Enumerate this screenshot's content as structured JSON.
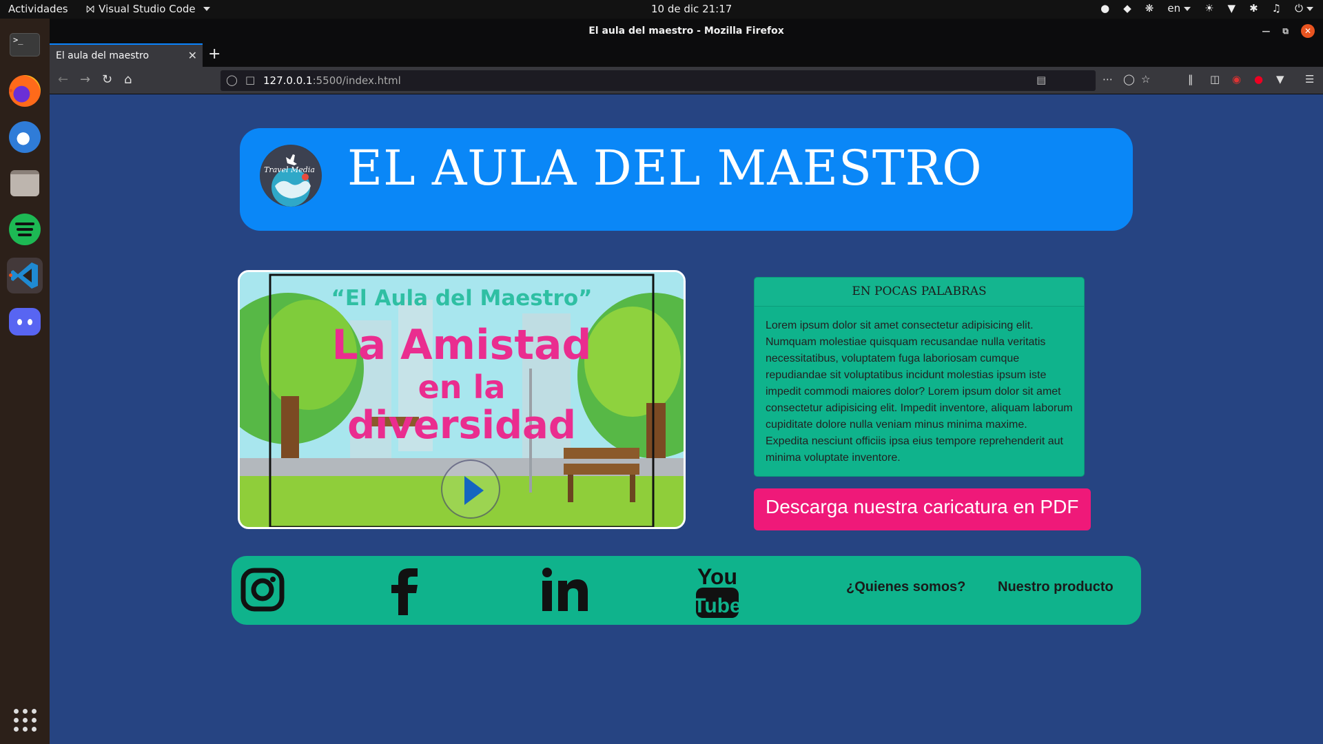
{
  "system": {
    "activities": "Actividades",
    "app_menu": "Visual Studio Code",
    "clock": "10 de dic  21:17",
    "language": "en"
  },
  "browser": {
    "window_title": "El aula del maestro - Mozilla Firefox",
    "tab_title": "El aula del maestro",
    "url_host": "127.0.0.1",
    "url_rest": ":5500/index.html"
  },
  "page": {
    "header_title": "EL AULA DEL MAESTRO",
    "logo_text": "Travel Media",
    "video": {
      "line1": "“El Aula del Maestro”",
      "line2": "La Amistad",
      "line3": "en la",
      "line4": "diversidad"
    },
    "card": {
      "title": "EN POCAS PALABRAS",
      "body": "Lorem ipsum dolor sit amet consectetur adipisicing elit. Numquam molestiae quisquam recusandae nulla veritatis necessitatibus, voluptatem fuga laboriosam cumque repudiandae sit voluptatibus incidunt molestias ipsum iste impedit commodi maiores dolor? Lorem ipsum dolor sit amet consectetur adipisicing elit. Impedit inventore, aliquam laborum cupiditate dolore nulla veniam minus minima maxime. Expedita nesciunt officiis ipsa eius tempore reprehenderit aut minima voluptate inventore."
    },
    "pdf_button": "Descarga nuestra caricatura en PDF",
    "footer": {
      "youtube_top": "You",
      "youtube_bottom": "Tube",
      "links": [
        "¿Quienes somos?",
        "Nuestro producto"
      ]
    }
  },
  "colors": {
    "page_bg": "#264482",
    "header_bg": "#0a87f7",
    "card_bg": "#0fb38c",
    "pdf_button_bg": "#ef1979"
  }
}
